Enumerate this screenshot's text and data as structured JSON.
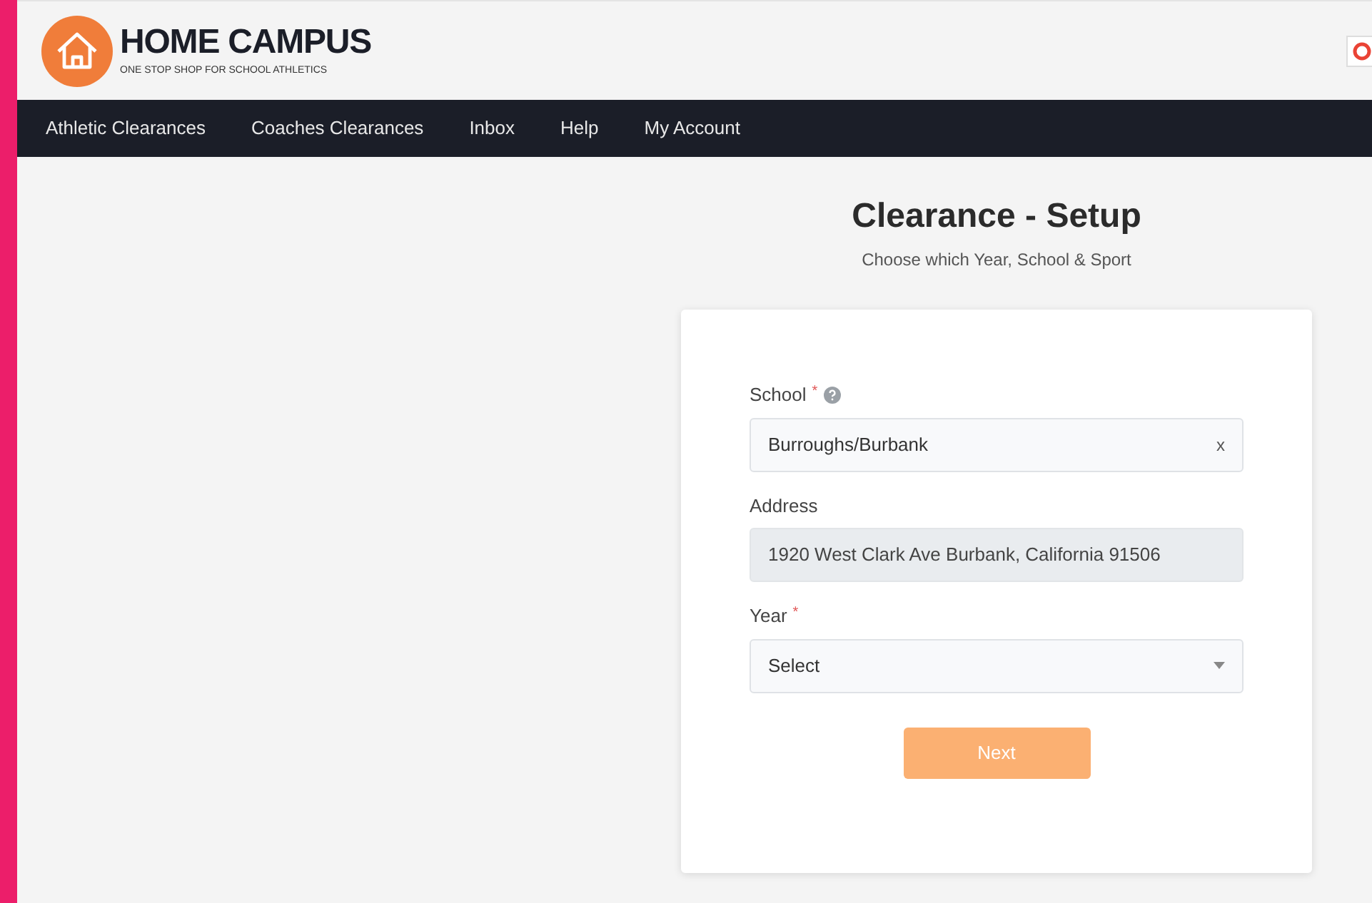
{
  "brand": {
    "name": "HOME CAMPUS",
    "tagline": "ONE STOP SHOP FOR SCHOOL ATHLETICS"
  },
  "nav": [
    {
      "label": "Athletic Clearances"
    },
    {
      "label": "Coaches Clearances"
    },
    {
      "label": "Inbox"
    },
    {
      "label": "Help"
    },
    {
      "label": "My Account"
    }
  ],
  "page": {
    "title": "Clearance - Setup",
    "subtitle": "Choose which Year, School & Sport"
  },
  "form": {
    "fields": [
      {
        "kind": "search",
        "label": "School",
        "required": "*",
        "help": true,
        "value": "Burroughs/Burbank",
        "clear": "x"
      },
      {
        "kind": "readonly",
        "label": "Address",
        "value": "1920 West Clark Ave Burbank, California 91506"
      },
      {
        "kind": "select",
        "label": "Year",
        "required": "*",
        "value": "Select"
      }
    ],
    "submit": {
      "label": "Next",
      "disabled": true
    }
  }
}
